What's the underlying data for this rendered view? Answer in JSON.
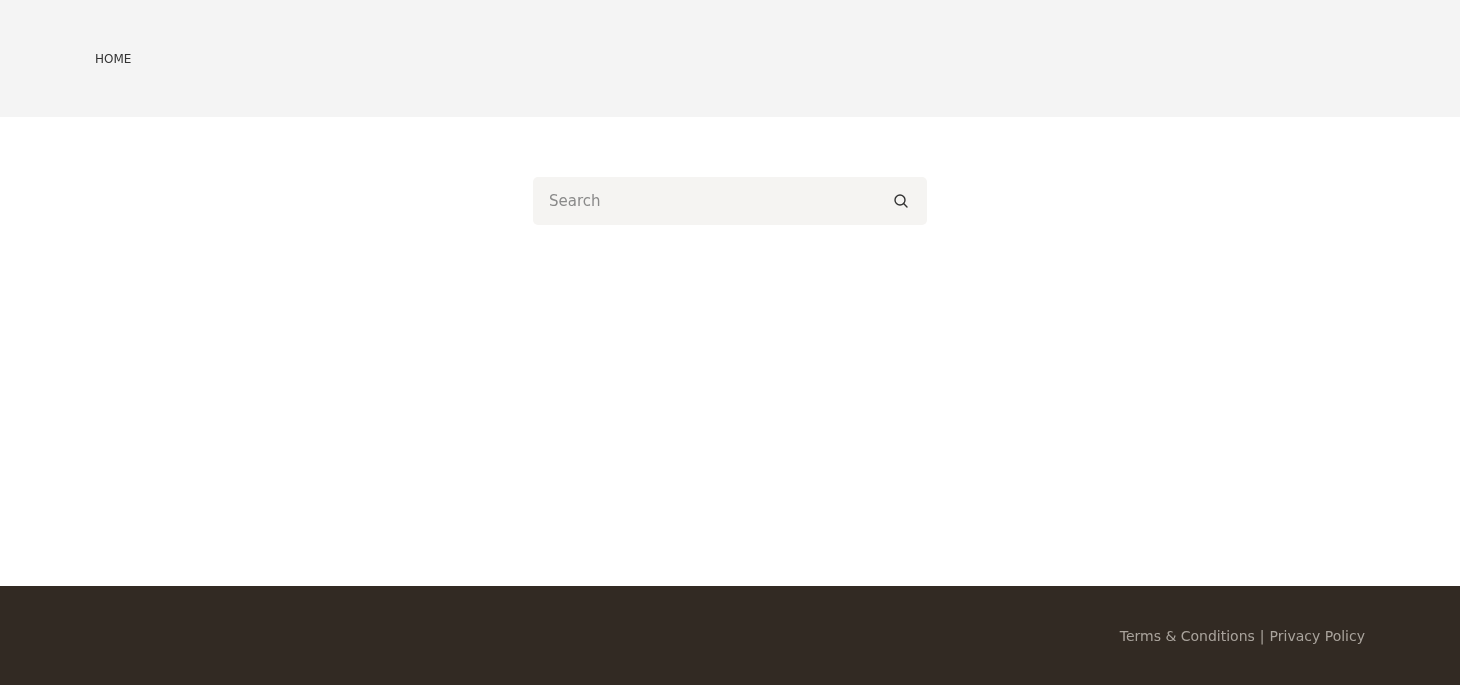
{
  "header": {
    "nav": [
      {
        "label": "HOME"
      }
    ]
  },
  "search": {
    "placeholder": "Search"
  },
  "footer": {
    "links": [
      {
        "label": "Terms & Conditions"
      },
      {
        "label": "Privacy Policy"
      }
    ],
    "separator": "|"
  }
}
